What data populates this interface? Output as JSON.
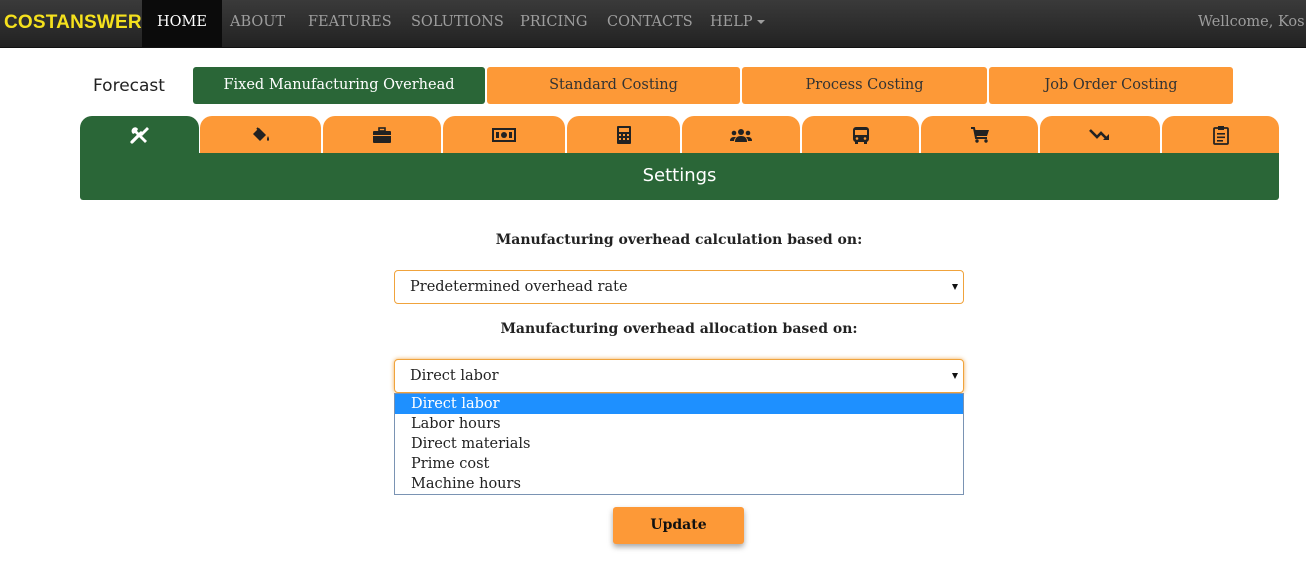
{
  "navbar": {
    "brand": "COSTANSWER",
    "items": [
      {
        "label": "HOME",
        "active": true
      },
      {
        "label": "ABOUT"
      },
      {
        "label": "FEATURES"
      },
      {
        "label": "SOLUTIONS"
      },
      {
        "label": "PRICING"
      },
      {
        "label": "CONTACTS"
      },
      {
        "label": "HELP"
      }
    ],
    "user": "Wellcome, Kos"
  },
  "modules": {
    "title": "Forecast",
    "tabs": [
      {
        "label": "Fixed Manufacturing Overhead",
        "active": true
      },
      {
        "label": "Standard Costing"
      },
      {
        "label": "Process Costing"
      },
      {
        "label": "Job Order Costing"
      }
    ]
  },
  "icon_tabs": [
    {
      "icon": "tools-icon",
      "active": true
    },
    {
      "icon": "paint-bucket-icon"
    },
    {
      "icon": "briefcase-icon"
    },
    {
      "icon": "money-icon"
    },
    {
      "icon": "calculator-icon"
    },
    {
      "icon": "users-icon"
    },
    {
      "icon": "bus-icon"
    },
    {
      "icon": "cart-icon"
    },
    {
      "icon": "trend-down-icon"
    },
    {
      "icon": "clipboard-icon"
    }
  ],
  "section": {
    "title": "Settings"
  },
  "form": {
    "calc_label": "Manufacturing overhead calculation based on:",
    "calc_value": "Predetermined overhead rate",
    "alloc_label": "Manufacturing overhead allocation based on:",
    "alloc_value": "Direct labor",
    "alloc_options": [
      "Direct labor",
      "Labor hours",
      "Direct materials",
      "Prime cost",
      "Machine hours"
    ],
    "alloc_selected_index": 0,
    "update_label": "Update"
  },
  "colors": {
    "green": "#2a6637",
    "orange": "#fd9937",
    "brand": "#f5e11d",
    "highlight": "#1e90ff"
  }
}
